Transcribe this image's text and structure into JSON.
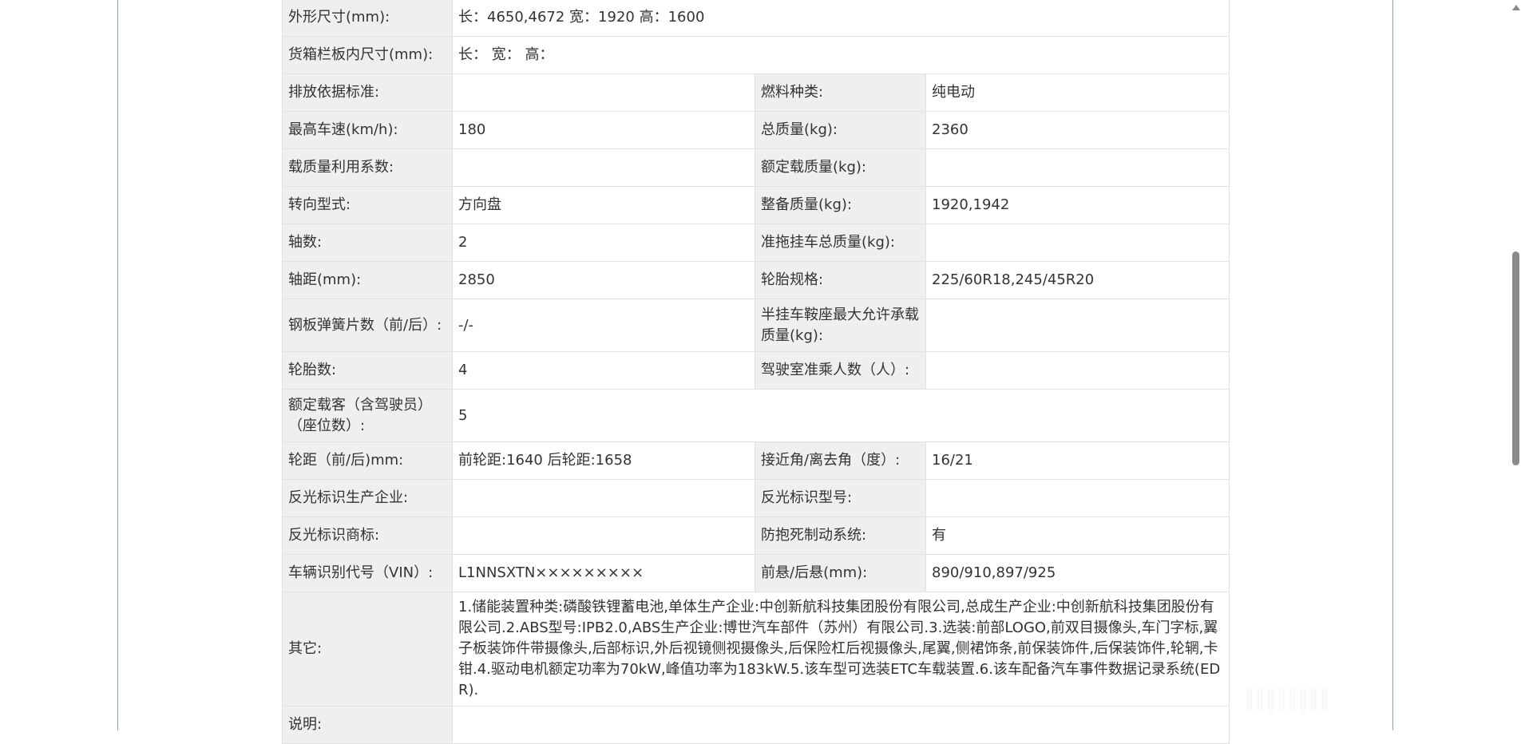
{
  "rows": [
    {
      "l1": "外形尺寸(mm):",
      "v1": "长：4650,4672 宽：1920 高：1600"
    },
    {
      "l1": "货箱栏板内尺寸(mm):",
      "v1": "长： 宽： 高："
    },
    {
      "l1": "排放依据标准:",
      "v1": "",
      "l2": "燃料种类:",
      "v2": "纯电动"
    },
    {
      "l1": "最高车速(km/h):",
      "v1": "180",
      "l2": "总质量(kg):",
      "v2": "2360"
    },
    {
      "l1": "载质量利用系数:",
      "v1": "",
      "l2": "额定载质量(kg):",
      "v2": ""
    },
    {
      "l1": "转向型式:",
      "v1": "方向盘",
      "l2": "整备质量(kg):",
      "v2": "1920,1942"
    },
    {
      "l1": "轴数:",
      "v1": "2",
      "l2": "准拖挂车总质量(kg):",
      "v2": ""
    },
    {
      "l1": "轴距(mm):",
      "v1": "2850",
      "l2": "轮胎规格:",
      "v2": "225/60R18,245/45R20"
    },
    {
      "l1": "钢板弹簧片数（前/后）:",
      "v1": "-/-",
      "l2": "半挂车鞍座最大允许承载质量(kg):",
      "v2": ""
    },
    {
      "l1": "轮胎数:",
      "v1": "4",
      "l2": "驾驶室准乘人数（人）:",
      "v2": ""
    },
    {
      "l1": "额定载客（含驾驶员）（座位数）:",
      "v1": "5"
    },
    {
      "l1": "轮距（前/后)mm:",
      "v1": "前轮距:1640 后轮距:1658",
      "l2": "接近角/离去角（度）:",
      "v2": "16/21"
    },
    {
      "l1": "反光标识生产企业:",
      "v1": "",
      "l2": "反光标识型号:",
      "v2": ""
    },
    {
      "l1": "反光标识商标:",
      "v1": "",
      "l2": "防抱死制动系统:",
      "v2": "有"
    },
    {
      "l1": "车辆识别代号（VIN）:",
      "v1": "L1NNSXTN×××××××××",
      "l2": "前悬/后悬(mm):",
      "v2": "890/910,897/925"
    },
    {
      "l1": "其它:",
      "v1": "1.储能装置种类:磷酸铁锂蓄电池,单体生产企业:中创新航科技集团股份有限公司,总成生产企业:中创新航科技集团股份有限公司.2.ABS型号:IPB2.0,ABS生产企业:博世汽车部件（苏州）有限公司.3.选装:前部LOGO,前双目摄像头,车门字标,翼子板装饰件带摄像头,后部标识,外后视镜侧视摄像头,后保险杠后视摄像头,尾翼,侧裙饰条,前保装饰件,后保装饰件,轮辋,卡钳.4.驱动电机额定功率为70kW,峰值功率为183kW.5.该车型可选装ETC车载装置.6.该车配备汽车事件数据记录系统(EDR)."
    },
    {
      "l1": "说明:",
      "v1": ""
    }
  ],
  "watermark": "||||||||"
}
